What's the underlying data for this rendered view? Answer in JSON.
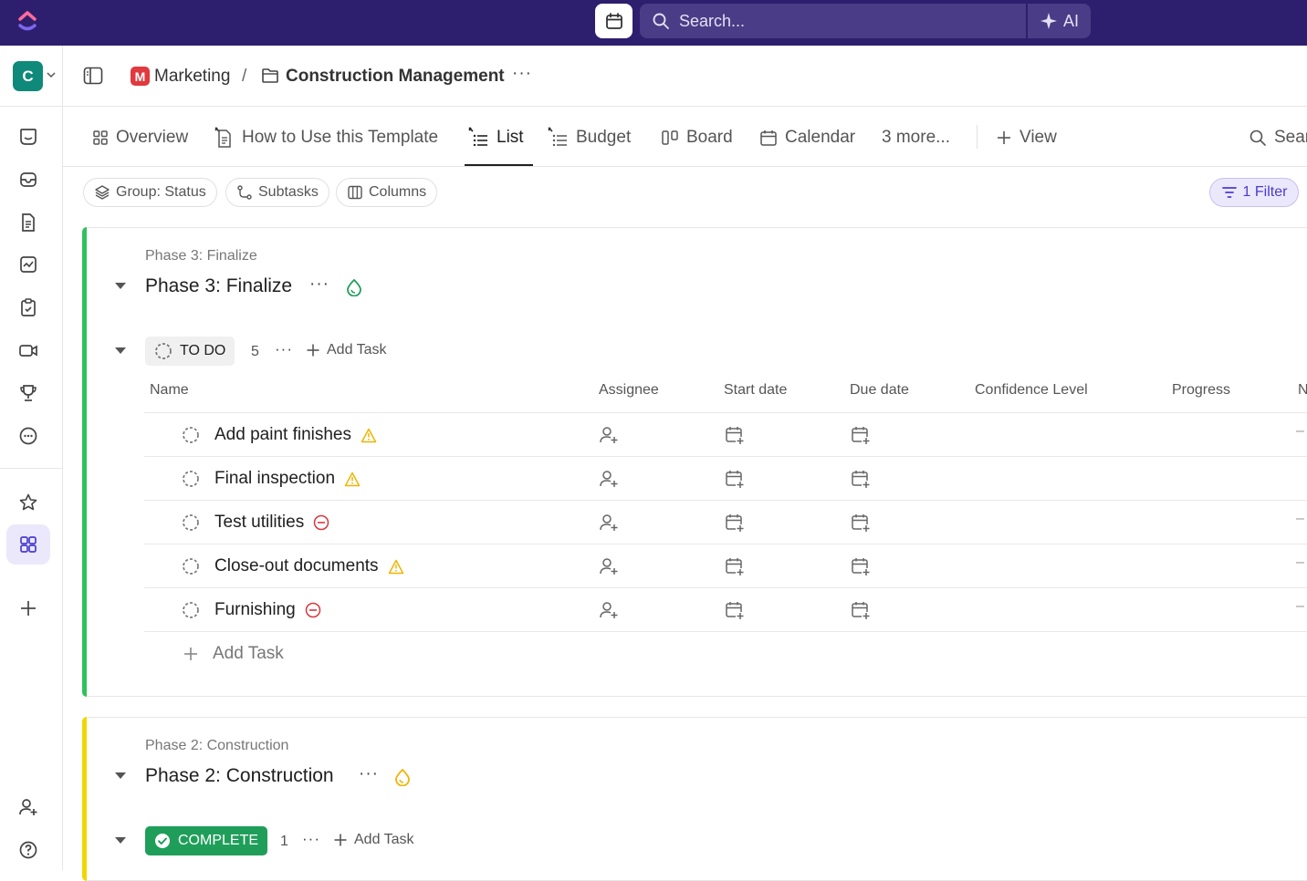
{
  "topbar": {
    "search_placeholder": "Search...",
    "ai_label": "AI"
  },
  "rail": {
    "workspace_initial": "C"
  },
  "breadcrumb": {
    "space": "Marketing",
    "space_initial": "M",
    "separator": "/",
    "folder": "Construction Management",
    "more": "···"
  },
  "tabs": [
    {
      "label": "Overview",
      "icon": "overview-icon"
    },
    {
      "label": "How to Use this Template",
      "icon": "doc-icon"
    },
    {
      "label": "List",
      "icon": "list-icon",
      "active": true
    },
    {
      "label": "Budget",
      "icon": "list-icon"
    },
    {
      "label": "Board",
      "icon": "board-icon"
    },
    {
      "label": "Calendar",
      "icon": "calendar-icon"
    },
    {
      "label": "3 more...",
      "icon": ""
    },
    {
      "label": "View",
      "icon": "plus-icon"
    },
    {
      "label": "Sear",
      "icon": "search-icon"
    }
  ],
  "toolbar": {
    "group_label": "Group: Status",
    "subtasks_label": "Subtasks",
    "columns_label": "Columns",
    "filter_label": "1 Filter"
  },
  "columns": [
    "Name",
    "Assignee",
    "Start date",
    "Due date",
    "Confidence Level",
    "Progress",
    "N"
  ],
  "groups": [
    {
      "subtitle": "Phase 3: Finalize",
      "title": "Phase 3: Finalize",
      "more": "···",
      "status": "TO DO",
      "count": "5",
      "add_task": "Add Task",
      "tasks": [
        {
          "name": "Add paint finishes",
          "priority": "warning"
        },
        {
          "name": "Final inspection",
          "priority": "warning"
        },
        {
          "name": "Test utilities",
          "priority": "blocked"
        },
        {
          "name": "Close-out documents",
          "priority": "warning"
        },
        {
          "name": "Furnishing",
          "priority": "blocked"
        }
      ],
      "row_dash": "–",
      "add_task_row": "Add Task"
    },
    {
      "subtitle": "Phase 2: Construction",
      "title": "Phase 2: Construction",
      "more": "···",
      "status": "COMPLETE",
      "count": "1",
      "add_task": "Add Task"
    }
  ],
  "colors": {
    "topbar": "#2e1f6e",
    "accent": "#4b3bcf",
    "phase3": "#2fc25b",
    "phase2": "#f2d600",
    "complete": "#1f9e5a",
    "warning": "#f0b400",
    "blocked": "#d9363e"
  }
}
